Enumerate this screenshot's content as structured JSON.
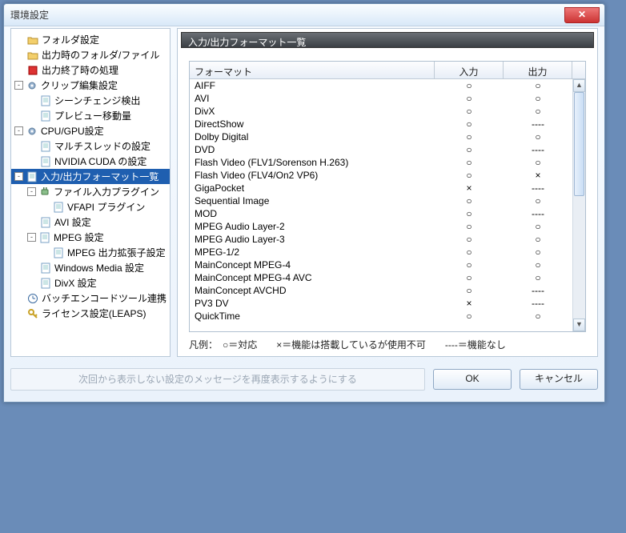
{
  "window": {
    "title": "環境設定"
  },
  "tree": [
    {
      "depth": 0,
      "twist": "",
      "icon": "folder",
      "label": "フォルダ設定"
    },
    {
      "depth": 0,
      "twist": "",
      "icon": "folder",
      "label": "出力時のフォルダ/ファイル"
    },
    {
      "depth": 0,
      "twist": "",
      "icon": "stop",
      "label": "出力終了時の処理"
    },
    {
      "depth": 0,
      "twist": "-",
      "icon": "gear",
      "label": "クリップ編集設定"
    },
    {
      "depth": 1,
      "twist": "",
      "icon": "page",
      "label": "シーンチェンジ検出"
    },
    {
      "depth": 1,
      "twist": "",
      "icon": "page",
      "label": "プレビュー移動量"
    },
    {
      "depth": 0,
      "twist": "-",
      "icon": "gear",
      "label": "CPU/GPU設定"
    },
    {
      "depth": 1,
      "twist": "",
      "icon": "page",
      "label": "マルチスレッドの設定"
    },
    {
      "depth": 1,
      "twist": "",
      "icon": "page",
      "label": "NVIDIA CUDA の設定"
    },
    {
      "depth": 0,
      "twist": "-",
      "icon": "page",
      "label": "入力/出力フォーマット一覧",
      "selected": true
    },
    {
      "depth": 1,
      "twist": "-",
      "icon": "plug",
      "label": "ファイル入力プラグイン"
    },
    {
      "depth": 2,
      "twist": "",
      "icon": "page",
      "label": "VFAPI プラグイン"
    },
    {
      "depth": 1,
      "twist": "",
      "icon": "page",
      "label": "AVI 設定"
    },
    {
      "depth": 1,
      "twist": "-",
      "icon": "page",
      "label": "MPEG 設定"
    },
    {
      "depth": 2,
      "twist": "",
      "icon": "page",
      "label": "MPEG 出力拡張子設定"
    },
    {
      "depth": 1,
      "twist": "",
      "icon": "page",
      "label": "Windows Media 設定"
    },
    {
      "depth": 1,
      "twist": "",
      "icon": "page",
      "label": "DivX 設定"
    },
    {
      "depth": 0,
      "twist": "",
      "icon": "clock",
      "label": "バッチエンコードツール連携"
    },
    {
      "depth": 0,
      "twist": "",
      "icon": "key",
      "label": "ライセンス設定(LEAPS)"
    }
  ],
  "section": {
    "header": "入力/出力フォーマット一覧"
  },
  "table": {
    "columns": {
      "format": "フォーマット",
      "input": "入力",
      "output": "出力"
    },
    "rows": [
      {
        "format": "AIFF",
        "input": "○",
        "output": "○"
      },
      {
        "format": "AVI",
        "input": "○",
        "output": "○"
      },
      {
        "format": "DivX",
        "input": "○",
        "output": "○"
      },
      {
        "format": "DirectShow",
        "input": "○",
        "output": "----"
      },
      {
        "format": "Dolby Digital",
        "input": "○",
        "output": "○"
      },
      {
        "format": "DVD",
        "input": "○",
        "output": "----"
      },
      {
        "format": "Flash Video (FLV1/Sorenson H.263)",
        "input": "○",
        "output": "○"
      },
      {
        "format": "Flash Video (FLV4/On2 VP6)",
        "input": "○",
        "output": "×"
      },
      {
        "format": "GigaPocket",
        "input": "×",
        "output": "----"
      },
      {
        "format": "Sequential Image",
        "input": "○",
        "output": "○"
      },
      {
        "format": "MOD",
        "input": "○",
        "output": "----"
      },
      {
        "format": "MPEG Audio Layer-2",
        "input": "○",
        "output": "○"
      },
      {
        "format": "MPEG Audio Layer-3",
        "input": "○",
        "output": "○"
      },
      {
        "format": "MPEG-1/2",
        "input": "○",
        "output": "○"
      },
      {
        "format": "MainConcept MPEG-4",
        "input": "○",
        "output": "○"
      },
      {
        "format": "MainConcept MPEG-4 AVC",
        "input": "○",
        "output": "○"
      },
      {
        "format": "MainConcept AVCHD",
        "input": "○",
        "output": "----"
      },
      {
        "format": "PV3 DV",
        "input": "×",
        "output": "----"
      },
      {
        "format": "QuickTime",
        "input": "○",
        "output": "○"
      }
    ],
    "legend": "凡例：　○＝対応　　×＝機能は搭載しているが使用不可　　----＝機能なし"
  },
  "footer": {
    "reshow": "次回から表示しない設定のメッセージを再度表示するようにする",
    "ok": "OK",
    "cancel": "キャンセル"
  }
}
